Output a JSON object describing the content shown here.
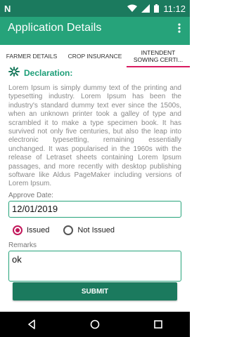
{
  "status_bar": {
    "time": "11:12",
    "left_icon": "N"
  },
  "app_bar": {
    "title": "Application Details",
    "overflow_icon": "more-vert-icon"
  },
  "tabs": [
    {
      "label": "FARMER DETAILS",
      "active": false
    },
    {
      "label": "CROP INSURANCE",
      "active": false
    },
    {
      "label": "INTENDENT SOWING CERTI...",
      "active": true
    }
  ],
  "declaration": {
    "title": "Declaration:",
    "text": "Lorem Ipsum is simply dummy text of the printing and typesetting industry. Lorem Ipsum has been the industry's standard dummy text ever since the 1500s, when an unknown printer took a galley of type and scrambled it to make a type specimen book. It has survived not only five centuries, but also the leap into electronic typesetting, remaining essentially unchanged. It was popularised in the 1960s with the release of Letraset sheets containing Lorem Ipsum passages, and more recently with desktop publishing software like Aldus PageMaker including versions of Lorem Ipsum."
  },
  "form": {
    "approve_date_label": "Approve Date:",
    "approve_date_value": "12/01/2019",
    "radio_issued": "Issued",
    "radio_not_issued": "Not Issued",
    "selected": "Issued",
    "remarks_label": "Remarks",
    "remarks_value": "ok",
    "submit_label": "SUBMIT"
  },
  "colors": {
    "primary": "#26a37a",
    "primary_dark": "#1b7a5e",
    "accent": "#c2185b"
  }
}
